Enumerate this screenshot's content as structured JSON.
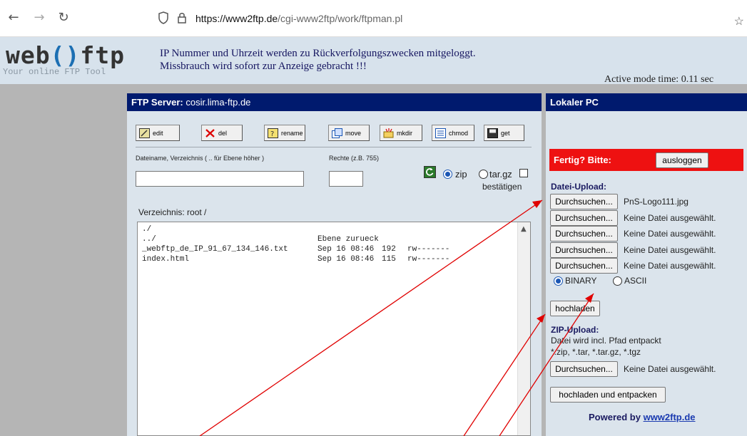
{
  "browser": {
    "url_host": "https://www2ftp.de",
    "url_path": "/cgi-www2ftp/work/ftpman.pl",
    "back_icon": "arrow-left-icon",
    "forward_icon": "arrow-right-icon",
    "reload_icon": "reload-icon"
  },
  "header": {
    "logo_web": "web",
    "logo_paren": "()",
    "logo_ftp": "ftp",
    "logo_sub": "Your online FTP Tool",
    "notice_line1": "IP Nummer und Uhrzeit werden zu Rückverfolgungszwecken mitgeloggt.",
    "notice_line2": "Missbrauch wird sofort zur Anzeige gebracht !!!",
    "active_mode": "Active mode   time: 0.11 sec"
  },
  "ftp": {
    "title_label": "FTP Server:",
    "server": "cosir.lima-ftp.de",
    "toolbar": {
      "edit": "edit",
      "del": "del",
      "rename": "rename",
      "move": "move",
      "mkdir": "mkdir",
      "chmod": "chmod",
      "get": "get"
    },
    "name_label": "Dateiname, Verzeichnis ( .. für Ebene höher )",
    "rights_label": "Rechte (z.B. 755)",
    "name_value": "",
    "rights_value": "",
    "zip_label": "zip",
    "targz_label": "tar.gz",
    "confirm_label": "bestätigen",
    "dir_label": "Verzeichnis:  root /",
    "files": [
      {
        "name": "./",
        "date": "",
        "size": "",
        "perm": ""
      },
      {
        "name": "../",
        "date": "Ebene zurueck",
        "size": "",
        "perm": ""
      },
      {
        "name": "_webftp_de_IP_91_67_134_146.txt",
        "date": "Sep 16 08:46",
        "size": "192",
        "perm": "rw-------"
      },
      {
        "name": "index.html",
        "date": "Sep 16 08:46",
        "size": "115",
        "perm": "rw-------"
      }
    ]
  },
  "local": {
    "title": "Lokaler PC",
    "fertig_label": "Fertig? Bitte:",
    "logout_button": "ausloggen",
    "upload_title": "Datei-Upload:",
    "browse_label": "Durchsuchen...",
    "upload_files": [
      "PnS-Logo111.jpg",
      "Keine Datei ausgewählt.",
      "Keine Datei ausgewählt.",
      "Keine Datei ausgewählt.",
      "Keine Datei ausgewählt."
    ],
    "binary_label": "BINARY",
    "ascii_label": "ASCII",
    "upload_button": "hochladen",
    "zip_title": "ZIP-Upload:",
    "zip_info1": "Datei wird incl. Pfad entpackt",
    "zip_info2": "*.zip, *.tar, *.tar.gz, *.tgz",
    "zip_file_status": "Keine Datei ausgewählt.",
    "zip_button": "hochladen und entpacken",
    "powered_prefix": "Powered by ",
    "powered_link": "www2ftp.de"
  },
  "colors": {
    "header_bg": "#d7e2ec",
    "panel_title_bg": "#001a6e",
    "alert_red": "#ee1111",
    "annotation_red": "#e00000"
  }
}
